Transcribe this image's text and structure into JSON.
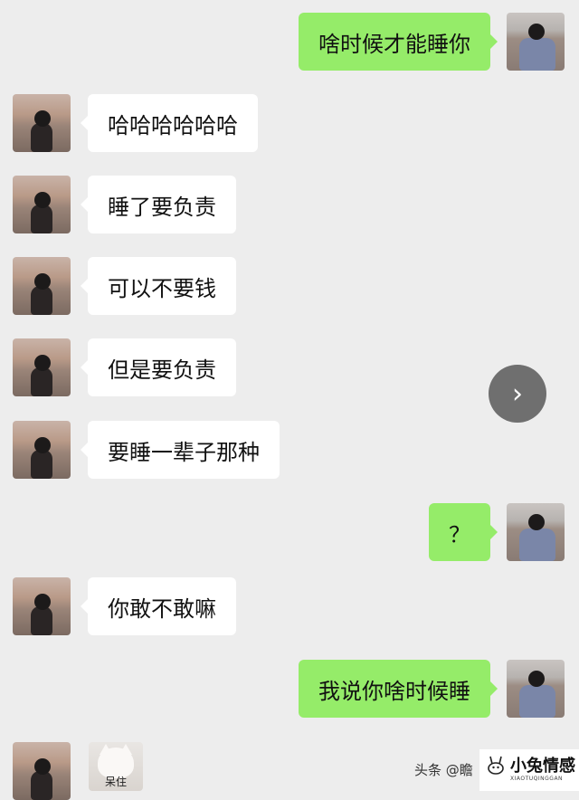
{
  "messages": [
    {
      "side": "right",
      "text": "啥时候才能睡你"
    },
    {
      "side": "left",
      "text": "哈哈哈哈哈哈"
    },
    {
      "side": "left",
      "text": "睡了要负责"
    },
    {
      "side": "left",
      "text": "可以不要钱"
    },
    {
      "side": "left",
      "text": "但是要负责"
    },
    {
      "side": "left",
      "text": "要睡一辈子那种"
    },
    {
      "side": "right",
      "text": "？"
    },
    {
      "side": "left",
      "text": "你敢不敢嘛"
    },
    {
      "side": "right",
      "text": "我说你啥时候睡"
    }
  ],
  "sticker": {
    "label": "呆住"
  },
  "overlay": {
    "next_icon": "chevron-right-icon",
    "next_glyph": "›"
  },
  "watermark": {
    "text": "头条 @瞻"
  },
  "brand": {
    "name": "小兔情感",
    "sub": "XIAOTUQINGGAN"
  },
  "colors": {
    "background": "#ededed",
    "self_bubble": "#95ec69",
    "other_bubble": "#ffffff"
  }
}
